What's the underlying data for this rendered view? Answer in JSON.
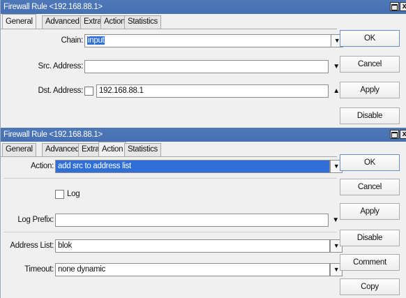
{
  "window1": {
    "title": "Firewall Rule <192.168.88.1>",
    "tabs": [
      "General",
      "Advanced",
      "Extra",
      "Action",
      "Statistics"
    ],
    "active_tab": "General",
    "fields": {
      "chain_label": "Chain:",
      "chain_value": "input",
      "src_address_label": "Src. Address:",
      "src_address_value": "",
      "dst_address_label": "Dst. Address:",
      "dst_address_value": "192.168.88.1"
    },
    "buttons": {
      "ok": "OK",
      "cancel": "Cancel",
      "apply": "Apply",
      "disable": "Disable"
    }
  },
  "window2": {
    "title": "Firewall Rule <192.168.88.1>",
    "tabs": [
      "General",
      "Advanced",
      "Extra",
      "Action",
      "Statistics"
    ],
    "active_tab": "Action",
    "fields": {
      "action_label": "Action:",
      "action_value": "add src to address list",
      "log_label": "Log",
      "log_checked": false,
      "log_prefix_label": "Log Prefix:",
      "log_prefix_value": "",
      "address_list_label": "Address List:",
      "address_list_value": "blok",
      "timeout_label": "Timeout:",
      "timeout_value": "none dynamic"
    },
    "buttons": {
      "ok": "OK",
      "cancel": "Cancel",
      "apply": "Apply",
      "disable": "Disable",
      "comment": "Comment",
      "copy": "Copy"
    }
  },
  "colors": {
    "titlebar": "#4570b2",
    "selection": "#2f6fd7",
    "window_bg": "#f0f0f0"
  },
  "icons": {
    "maximize": "maximize-icon",
    "close": "close-icon",
    "dropdown": "dropdown-arrow-icon",
    "collapse": "collapse-arrow-icon"
  }
}
